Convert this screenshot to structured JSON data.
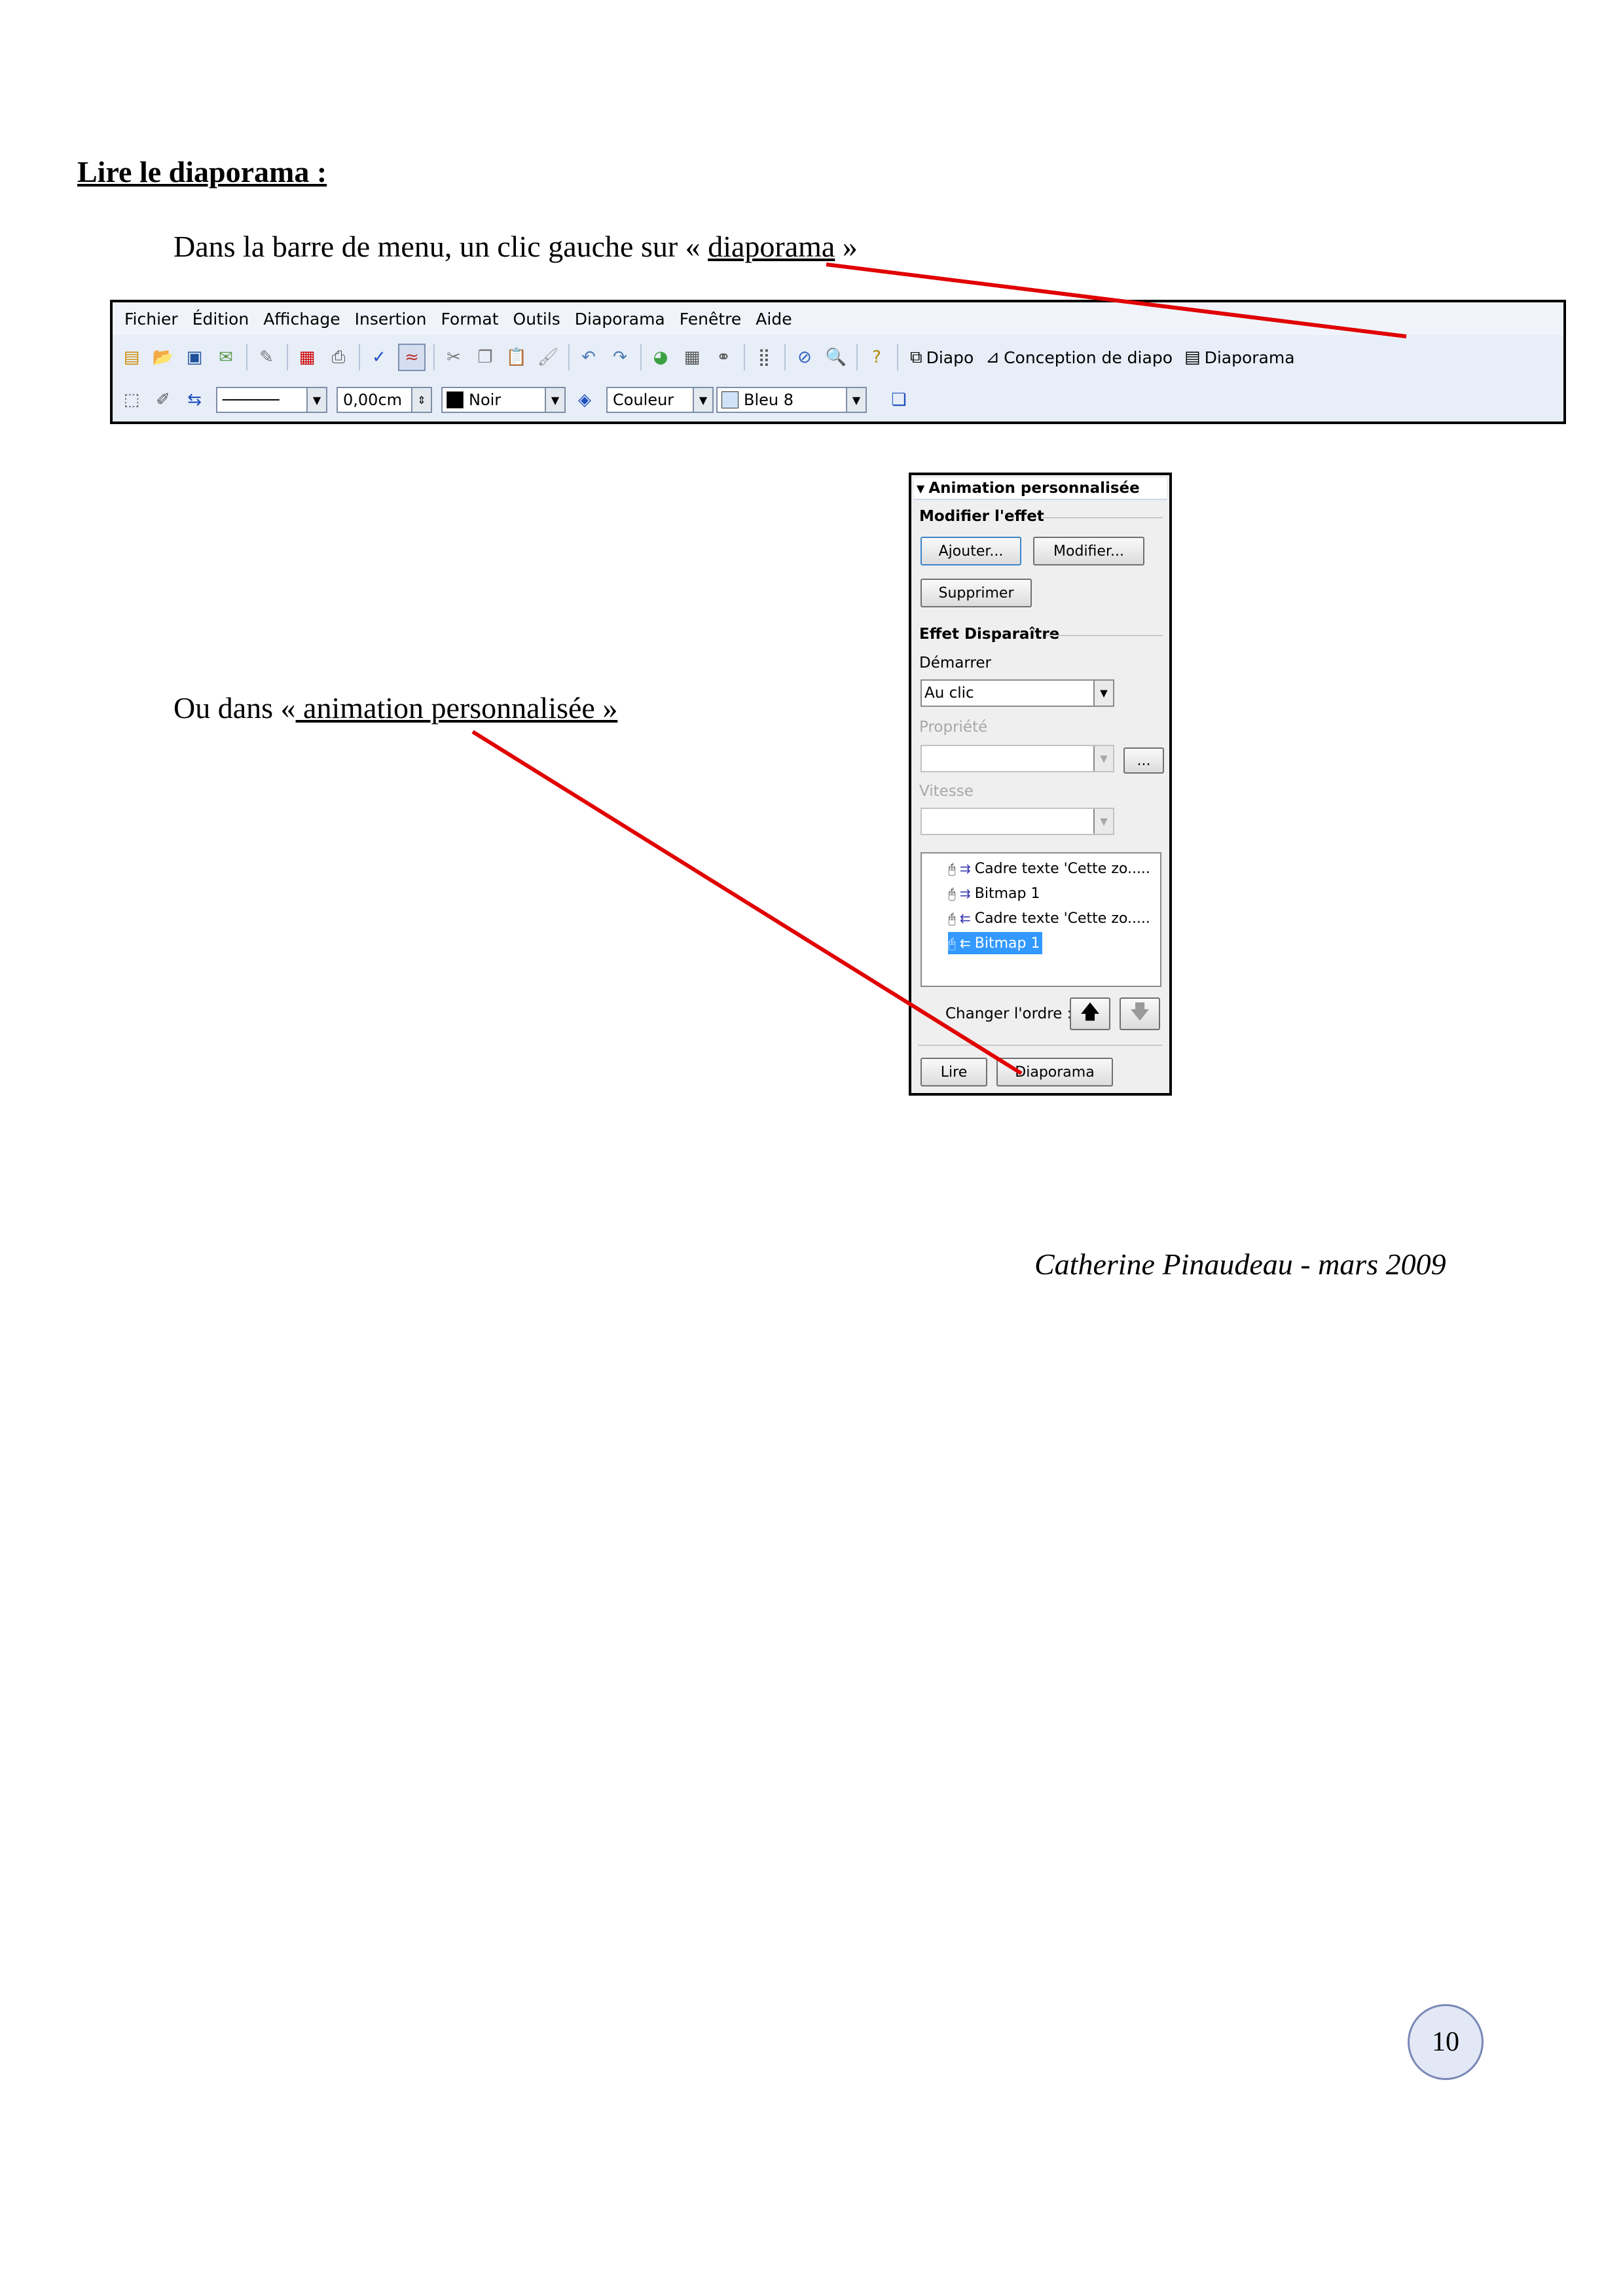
{
  "heading": "Lire le diaporama :",
  "instruction_1": {
    "before": "Dans la barre de menu, un clic gauche sur « ",
    "link": "diaporama",
    "after": " »"
  },
  "instruction_2": {
    "before": "Ou dans «",
    "link": " animation personnalisée »"
  },
  "toolbar": {
    "menu": [
      "Fichier",
      "Édition",
      "Affichage",
      "Insertion",
      "Format",
      "Outils",
      "Diaporama",
      "Fenêtre",
      "Aide"
    ],
    "buttons": {
      "diapo": "Diapo",
      "conception": "Conception de diapo",
      "diaporama": "Diaporama"
    },
    "line_width": "0,00cm",
    "line_color": "Noir",
    "line_color_hex": "#000000",
    "fill_type": "Couleur",
    "fill_color": "Bleu 8",
    "fill_color_hex": "#cfe2f8"
  },
  "panel": {
    "title": "Animation personnalisée",
    "section_modify": "Modifier l'effet",
    "btn_add": "Ajouter...",
    "btn_modify": "Modifier...",
    "btn_delete": "Supprimer",
    "section_effect": "Effet Disparaître",
    "label_start": "Démarrer",
    "start_value": "Au clic",
    "label_property": "Propriété",
    "label_speed": "Vitesse",
    "btn_more": "...",
    "list": [
      "Cadre texte 'Cette zo.....",
      "Bitmap 1",
      "Cadre texte 'Cette zo.....",
      "Bitmap 1"
    ],
    "label_order": "Changer l'ordre :",
    "btn_play": "Lire",
    "btn_slideshow": "Diaporama"
  },
  "author": "Catherine Pinaudeau  -  mars 2009",
  "page_number": "10",
  "colors": {
    "arrow": "#e00000",
    "selection": "#3399ff"
  }
}
